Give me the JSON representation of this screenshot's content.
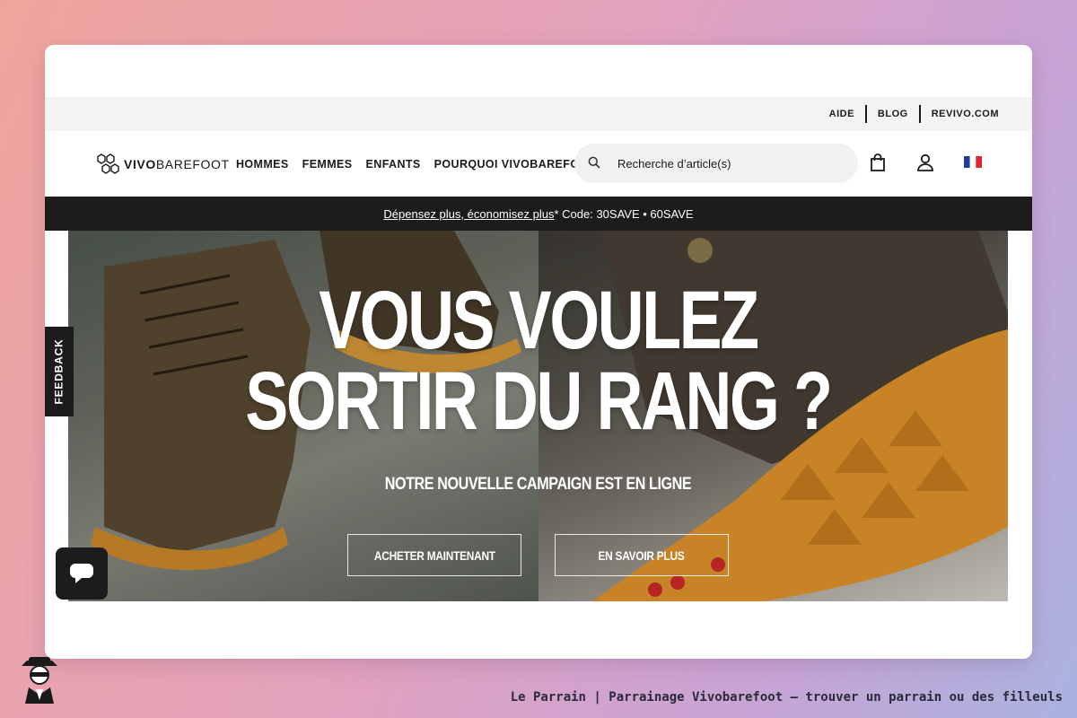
{
  "utility_links": [
    "AIDE",
    "BLOG",
    "REVIVO.COM"
  ],
  "logo": {
    "bold": "VIVO",
    "light": "BAREFOOT"
  },
  "nav": [
    "HOMMES",
    "FEMMES",
    "ENFANTS",
    "POURQUOI VIVOBAREFOOT"
  ],
  "search": {
    "placeholder": "Recherche d’article(s)"
  },
  "header_icons": [
    "bag-icon",
    "account-icon",
    "french-flag-icon"
  ],
  "promo": {
    "link_text": "Dépensez plus, économisez plus",
    "rest": "* Code: 30SAVE • 60SAVE"
  },
  "hero": {
    "line1": "VOUS VOULEZ",
    "line2": "SORTIR DU RANG ?",
    "subline": "NOTRE NOUVELLE CAMPAIGN EST EN LIGNE",
    "cta_primary": "ACHETER MAINTENANT",
    "cta_secondary": "EN SAVOIR PLUS"
  },
  "feedback": "FEEDBACK",
  "caption": "Le Parrain | Parrainage Vivobarefoot — trouver un parrain ou des filleuls",
  "colors": {
    "dark": "#1c1c1c",
    "utility_bg": "#f4f4f4",
    "search_bg": "#f1f1f1"
  }
}
